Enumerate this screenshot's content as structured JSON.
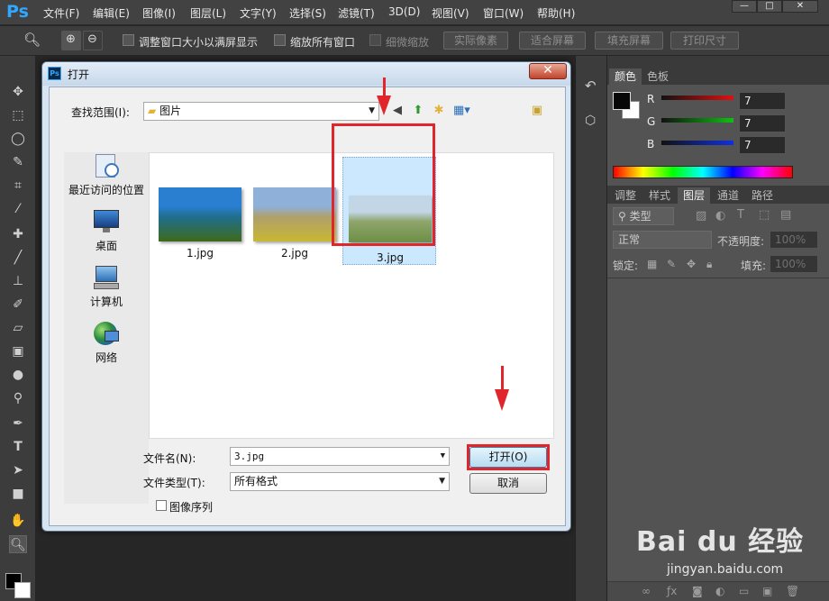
{
  "app": {
    "logo": "Ps"
  },
  "menu": [
    "文件(F)",
    "编辑(E)",
    "图像(I)",
    "图层(L)",
    "文字(Y)",
    "选择(S)",
    "滤镜(T)",
    "3D(D)",
    "视图(V)",
    "窗口(W)",
    "帮助(H)"
  ],
  "window_controls": {
    "minimize": "—",
    "maximize": "□",
    "close": "✕"
  },
  "options_bar": {
    "resize_windows": "调整窗口大小以满屏显示",
    "zoom_all": "缩放所有窗口",
    "scrubby_zoom": "细微缩放",
    "actual_pixels": "实际像素",
    "fit_screen": "适合屏幕",
    "fill_screen": "填充屏幕",
    "print_size": "打印尺寸"
  },
  "dialog": {
    "title": "打开",
    "close_icon": "close-icon",
    "look_in_label": "查找范围(I):",
    "look_in_value": "图片",
    "places": [
      {
        "label": "最近访问的位置",
        "icon": "recent-places-icon"
      },
      {
        "label": "桌面",
        "icon": "desktop-icon"
      },
      {
        "label": "计算机",
        "icon": "computer-icon"
      },
      {
        "label": "网络",
        "icon": "network-icon"
      }
    ],
    "files": [
      {
        "name": "1.jpg",
        "colors": [
          "#2a7fd0",
          "#1f6e8c",
          "#3e6a1c"
        ]
      },
      {
        "name": "2.jpg",
        "colors": [
          "#8fb0d8",
          "#b0a06a",
          "#c8b832"
        ]
      },
      {
        "name": "3.jpg",
        "colors": [
          "#c3d6e6",
          "#8fa56c",
          "#6d8f45"
        ]
      }
    ],
    "filename_label": "文件名(N):",
    "filename_value": "3.jpg",
    "filetype_label": "文件类型(T):",
    "filetype_value": "所有格式",
    "open_button": "打开(O)",
    "cancel_button": "取消",
    "image_sequence": "图像序列"
  },
  "color_panel": {
    "tabs": [
      "颜色",
      "色板"
    ],
    "channels": [
      {
        "label": "R",
        "value": "7",
        "color": "#e01010"
      },
      {
        "label": "G",
        "value": "7",
        "color": "#10c010"
      },
      {
        "label": "B",
        "value": "7",
        "color": "#1030e0"
      }
    ]
  },
  "layers_panel": {
    "tabs": [
      "调整",
      "样式",
      "图层",
      "通道",
      "路径"
    ],
    "active_tab": "图层",
    "filter_label": "类型",
    "blend_mode": "正常",
    "opacity_label": "不透明度:",
    "opacity_value": "100%",
    "lock_label": "锁定:",
    "fill_label": "填充:",
    "fill_value": "100%"
  },
  "watermark": {
    "brand": "Bai du 经验",
    "url": "jingyan.baidu.com"
  },
  "colors": {
    "accent": "#31a8ff",
    "highlight": "#e0262b",
    "selection": "#cce8ff"
  }
}
